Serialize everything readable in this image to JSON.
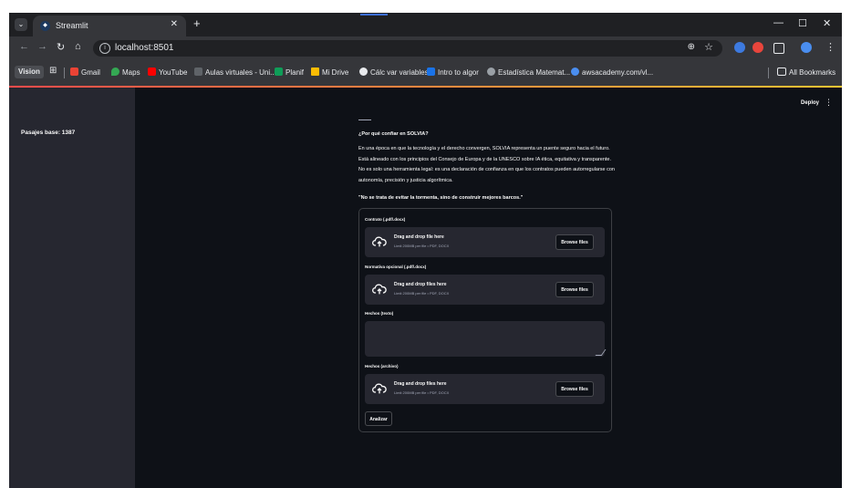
{
  "browser": {
    "tab_title": "Streamlit",
    "url": "localhost:8501",
    "bookmarks": [
      "Vision",
      "Gmail",
      "Maps",
      "YouTube",
      "Aulas virtuales - Uni...",
      "Planif",
      "Mi Drive",
      "Cálc var variables",
      "Intro to algor",
      "Estadística Matemat...",
      "awsacademy.com/vl..."
    ],
    "all_bookmarks": "All Bookmarks"
  },
  "app": {
    "sidebar_text": "Pasajes base: 1387",
    "deploy_label": "Deploy",
    "menu_label": "⋮",
    "heading": "¿Por qué confiar en SOLVIA?",
    "paragraph": "En una época en que la tecnología y el derecho convergen, SOLVIA representa un puente seguro hacia el futuro. Está alineado con los principios del Consejo de Europa y de la UNESCO sobre IA ética, equitativa y transparente. No es solo una herramienta legal: es una declaración de confianza en que los contratos pueden autorregularse con autonomía, precisión y justicia algorítmica.",
    "quote": "\"No se trata de evitar la tormenta, sino de construir mejores barcos.\"",
    "form": {
      "contrato_label": "Contrato (.pdf/.docx)",
      "contrato_drop_main": "Drag and drop file here",
      "contrato_drop_sub": "Limit 200MB per file • PDF, DOCX",
      "normativa_label": "Normativa opcional (.pdf/.docx)",
      "normativa_drop_main": "Drag and drop files here",
      "normativa_drop_sub": "Limit 200MB per file • PDF, DOCX",
      "hechos_texto_label": "Hechos (texto)",
      "hechos_archivo_label": "Hechos (archivo)",
      "hechos_drop_main": "Drag and drop files here",
      "hechos_drop_sub": "Limit 200MB per file • PDF, DOCX",
      "browse_label": "Browse files",
      "analyze_label": "Analizar"
    }
  },
  "colors": {
    "app_bg": "#0e1117",
    "sidebar_bg": "#262730",
    "input_bg": "#262730",
    "accent_red": "#ff4b4b",
    "accent_yellow": "#fdc433",
    "browser_chrome": "#35363a"
  },
  "icons": [
    "search-tabs-icon",
    "streamlit-favicon",
    "close-icon",
    "plus-icon",
    "minimize-icon",
    "maximize-icon",
    "close-window-icon",
    "back-icon",
    "forward-icon",
    "reload-icon",
    "home-icon",
    "site-info-icon",
    "zoom-icon",
    "star-icon",
    "upload-cloud-icon",
    "resize-grip-icon"
  ]
}
